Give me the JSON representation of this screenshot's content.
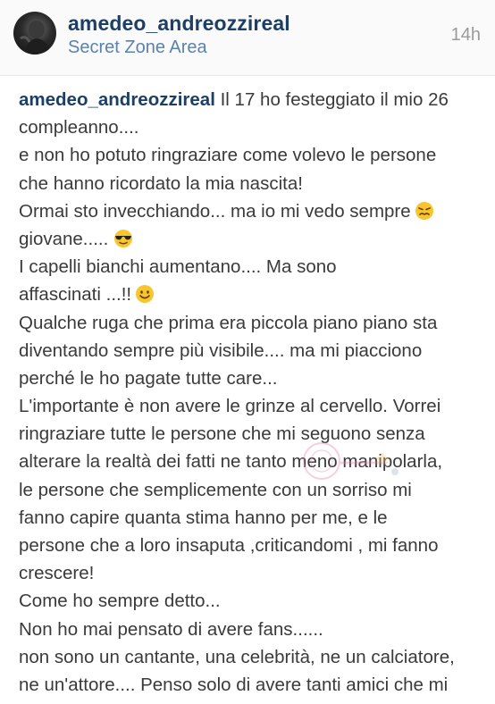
{
  "post": {
    "username": "amedeo_andreozzireal",
    "location": "Secret Zone Area",
    "time": "14h"
  },
  "caption": {
    "username": "amedeo_andreozzireal",
    "lines": [
      " Il 17 ho festeggiato il mio 26",
      "compleanno....",
      "e non ho potuto ringraziare come volevo le persone",
      "che hanno ricordato la mia nascita!",
      "Ormai sto invecchiando... ma io mi vedo sempre",
      "giovane.....",
      "I capelli bianchi aumentano.... Ma sono",
      "affascinati ...!!",
      "Qualche ruga che prima era piccola piano piano sta",
      "diventando sempre più visibile.... ma mi piacciono",
      "perché le ho pagate tutte care...",
      "L'importante è non avere le grinze al cervello. Vorrei",
      "ringraziare tutte le persone che mi seguono senza",
      "alterare la realtà dei fatti ne tanto meno manipolarla,",
      "le persone che semplicemente con un sorriso mi",
      "fanno capire quanta stima hanno per me, e le",
      "persone che a loro insaputa ,criticandomi , mi fanno",
      "crescere!",
      "Come ho sempre detto...",
      "Non ho mai pensato di avere fans......",
      "non sono un cantante, una celebrità, ne un calciatore,",
      "ne un'attore.... Penso solo di avere tanti amici che mi"
    ],
    "emojis": {
      "line4": "persevering-face-emoji",
      "line5": "sunglasses-face-emoji",
      "line7": "smiling-face-emoji"
    }
  },
  "colors": {
    "username": "#1b3f67",
    "location": "#5a82ad",
    "text": "#3a3a3a",
    "time": "#9a9a9a"
  }
}
